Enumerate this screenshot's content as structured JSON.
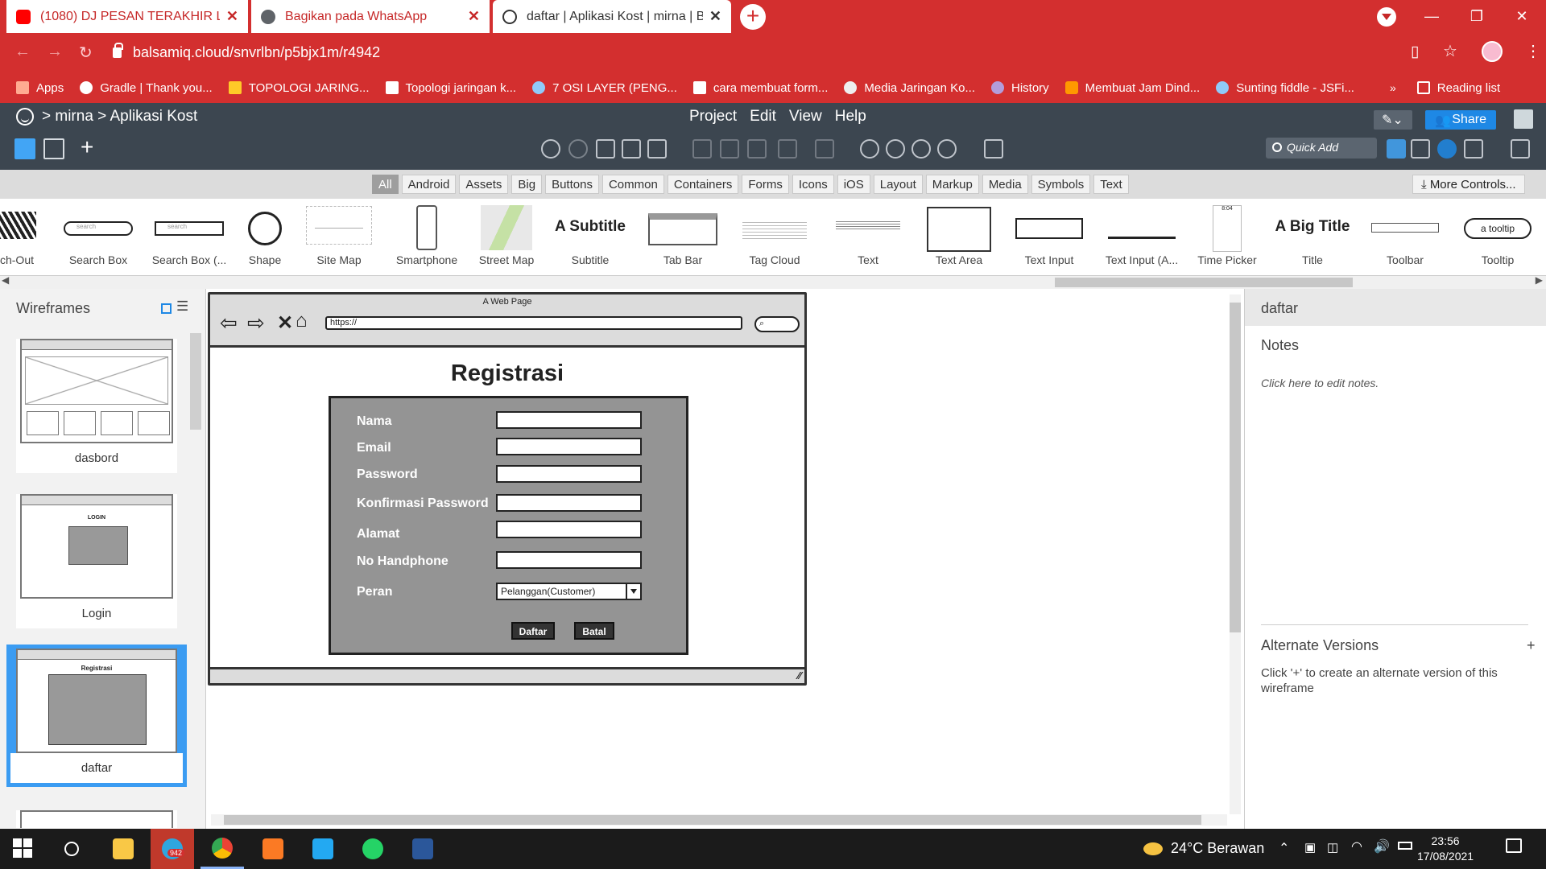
{
  "browser": {
    "tabs": [
      {
        "title": "(1080) DJ PESAN TERAKHIR LYOD",
        "icon": "youtube-icon",
        "color": "#ff0000"
      },
      {
        "title": "Bagikan pada WhatsApp",
        "icon": "globe-icon",
        "color": "#5f6368"
      },
      {
        "title": "daftar | Aplikasi Kost | mirna | Bal",
        "icon": "balsamiq-icon",
        "color": "#333333"
      }
    ],
    "url": "balsamiq.cloud/snvrlbn/p5bjx1m/r4942",
    "bookmarks": [
      {
        "label": "Apps",
        "icon": "apps-grid-icon"
      },
      {
        "label": "Gradle | Thank you...",
        "icon": "gradle-icon"
      },
      {
        "label": "TOPOLOGI JARING...",
        "icon": "folder-icon"
      },
      {
        "label": "Topologi jaringan k...",
        "icon": "site-icon"
      },
      {
        "label": "7 OSI LAYER (PENG...",
        "icon": "wordpress-icon"
      },
      {
        "label": "cara membuat form...",
        "icon": "code-icon"
      },
      {
        "label": "Media Jaringan Ko...",
        "icon": "wordpress-icon"
      },
      {
        "label": "History",
        "icon": "history-icon"
      },
      {
        "label": "Membuat Jam Dind...",
        "icon": "blogger-icon"
      },
      {
        "label": "Sunting fiddle - JSFi...",
        "icon": "jsfiddle-icon"
      }
    ],
    "reading_list": "Reading list"
  },
  "app": {
    "breadcrumb": "> mirna > Aplikasi Kost",
    "menu": [
      "Project",
      "Edit",
      "View",
      "Help"
    ],
    "quick_add": "Quick Add",
    "share": "Share",
    "filters": [
      "All",
      "Android",
      "Assets",
      "Big",
      "Buttons",
      "Common",
      "Containers",
      "Forms",
      "Icons",
      "iOS",
      "Layout",
      "Markup",
      "Media",
      "Symbols",
      "Text"
    ],
    "active_filter": "All",
    "more_controls": "More Controls...",
    "library": [
      "ch-Out",
      "Search Box",
      "Search Box (...",
      "Shape",
      "Site Map",
      "Smartphone",
      "Street Map",
      "Subtitle",
      "Tab Bar",
      "Tag Cloud",
      "Text",
      "Text Area",
      "Text Input",
      "Text Input (A...",
      "Time Picker",
      "Title",
      "Toolbar",
      "Tooltip"
    ],
    "library_previews": {
      "search": "search",
      "subtitle": "A Subtitle",
      "time": "8:04",
      "title": "A Big Title",
      "tooltip": "a tooltip"
    }
  },
  "navigator": {
    "title": "Wireframes",
    "wireframes": [
      "dasbord",
      "Login",
      "daftar"
    ],
    "selected": "daftar",
    "login_thumb_caption": "LOGIN",
    "daftar_thumb_caption": "Registrasi"
  },
  "mockup": {
    "page_title": "A Web Page",
    "url": "https://",
    "heading": "Registrasi",
    "fields": [
      "Nama",
      "Email",
      "Password",
      "Konfirmasi Password",
      "Alamat",
      "No Handphone"
    ],
    "role_label": "Peran",
    "role_value": "Pelanggan(Customer)",
    "submit": "Daftar",
    "cancel": "Batal"
  },
  "inspector": {
    "title": "daftar",
    "notes_title": "Notes",
    "notes_hint": "Click here to edit notes.",
    "alt_title": "Alternate Versions",
    "alt_plus": "+",
    "alt_hint": "Click '+' to create an alternate version of this wireframe"
  },
  "taskbar": {
    "telegram_badge": "942",
    "weather": "24°C  Berawan",
    "time": "23:56",
    "date": "17/08/2021"
  }
}
